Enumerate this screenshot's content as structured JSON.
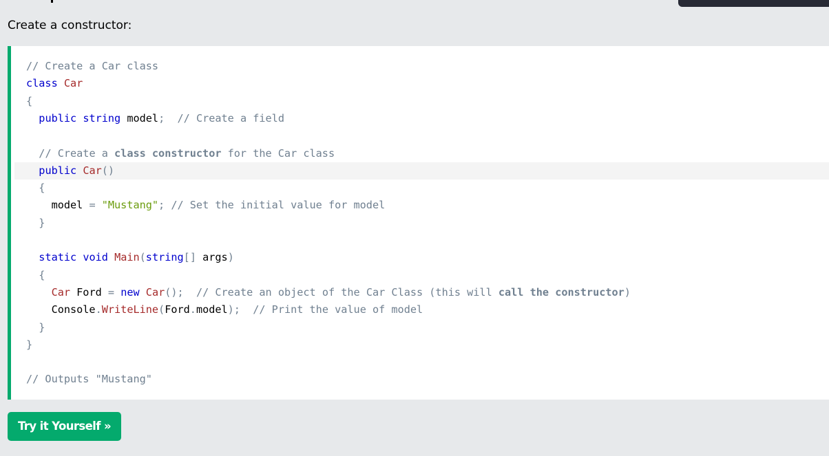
{
  "intro": {
    "text": "Create a constructor:"
  },
  "code": {
    "lines": [
      [
        {
          "t": "// Create a Car class",
          "c": "cm"
        }
      ],
      [
        {
          "t": "class",
          "c": "kw"
        },
        {
          "t": " "
        },
        {
          "t": "Car",
          "c": "cls"
        }
      ],
      [
        {
          "t": "{",
          "c": "pn"
        }
      ],
      [
        {
          "t": "  "
        },
        {
          "t": "public",
          "c": "kw"
        },
        {
          "t": " "
        },
        {
          "t": "string",
          "c": "kw"
        },
        {
          "t": " model"
        },
        {
          "t": ";",
          "c": "pn"
        },
        {
          "t": "  "
        },
        {
          "t": "// Create a field",
          "c": "cm"
        }
      ],
      [],
      [
        {
          "t": "  "
        },
        {
          "t": "// Create a ",
          "c": "cm"
        },
        {
          "t": "class",
          "c": "cmb"
        },
        {
          "t": " ",
          "c": "cm"
        },
        {
          "t": "constructor",
          "c": "cmb"
        },
        {
          "t": " for the Car class",
          "c": "cm"
        }
      ],
      [
        {
          "t": "  "
        },
        {
          "t": "public",
          "c": "kw"
        },
        {
          "t": " "
        },
        {
          "t": "Car",
          "c": "cls"
        },
        {
          "t": "()",
          "c": "pn"
        }
      ],
      [
        {
          "t": "  "
        },
        {
          "t": "{",
          "c": "pn"
        }
      ],
      [
        {
          "t": "    model "
        },
        {
          "t": "=",
          "c": "pn"
        },
        {
          "t": " "
        },
        {
          "t": "\"Mustang\"",
          "c": "str"
        },
        {
          "t": ";",
          "c": "pn"
        },
        {
          "t": " "
        },
        {
          "t": "// Set the initial value for model",
          "c": "cm"
        }
      ],
      [
        {
          "t": "  "
        },
        {
          "t": "}",
          "c": "pn"
        }
      ],
      [],
      [
        {
          "t": "  "
        },
        {
          "t": "static",
          "c": "kw"
        },
        {
          "t": " "
        },
        {
          "t": "void",
          "c": "kw"
        },
        {
          "t": " "
        },
        {
          "t": "Main",
          "c": "cls"
        },
        {
          "t": "(",
          "c": "pn"
        },
        {
          "t": "string",
          "c": "kw"
        },
        {
          "t": "[]",
          "c": "pn"
        },
        {
          "t": " args"
        },
        {
          "t": ")",
          "c": "pn"
        }
      ],
      [
        {
          "t": "  "
        },
        {
          "t": "{",
          "c": "pn"
        }
      ],
      [
        {
          "t": "    "
        },
        {
          "t": "Car",
          "c": "cls"
        },
        {
          "t": " Ford "
        },
        {
          "t": "=",
          "c": "pn"
        },
        {
          "t": " "
        },
        {
          "t": "new",
          "c": "kw"
        },
        {
          "t": " "
        },
        {
          "t": "Car",
          "c": "cls"
        },
        {
          "t": "();",
          "c": "pn"
        },
        {
          "t": "  "
        },
        {
          "t": "// Create an object of the Car Class (this will ",
          "c": "cm"
        },
        {
          "t": "call",
          "c": "cmb"
        },
        {
          "t": " ",
          "c": "cm"
        },
        {
          "t": "the",
          "c": "cmb"
        },
        {
          "t": " ",
          "c": "cm"
        },
        {
          "t": "constructor",
          "c": "cmb"
        },
        {
          "t": ")",
          "c": "cm"
        }
      ],
      [
        {
          "t": "    Console"
        },
        {
          "t": ".",
          "c": "pn"
        },
        {
          "t": "WriteLine",
          "c": "cls"
        },
        {
          "t": "(",
          "c": "pn"
        },
        {
          "t": "Ford"
        },
        {
          "t": ".",
          "c": "pn"
        },
        {
          "t": "model"
        },
        {
          "t": ");",
          "c": "pn"
        },
        {
          "t": "  "
        },
        {
          "t": "// Print the value of model",
          "c": "cm"
        }
      ],
      [
        {
          "t": "  "
        },
        {
          "t": "}",
          "c": "pn"
        }
      ],
      [
        {
          "t": "}",
          "c": "pn"
        }
      ],
      [],
      [
        {
          "t": "// Outputs \"Mustang\"",
          "c": "cm"
        }
      ]
    ]
  },
  "button": {
    "label": "Try it Yourself »"
  },
  "colors": {
    "accent": "#04aa6d",
    "background": "#e7e9eb",
    "code_background": "#ffffff"
  }
}
